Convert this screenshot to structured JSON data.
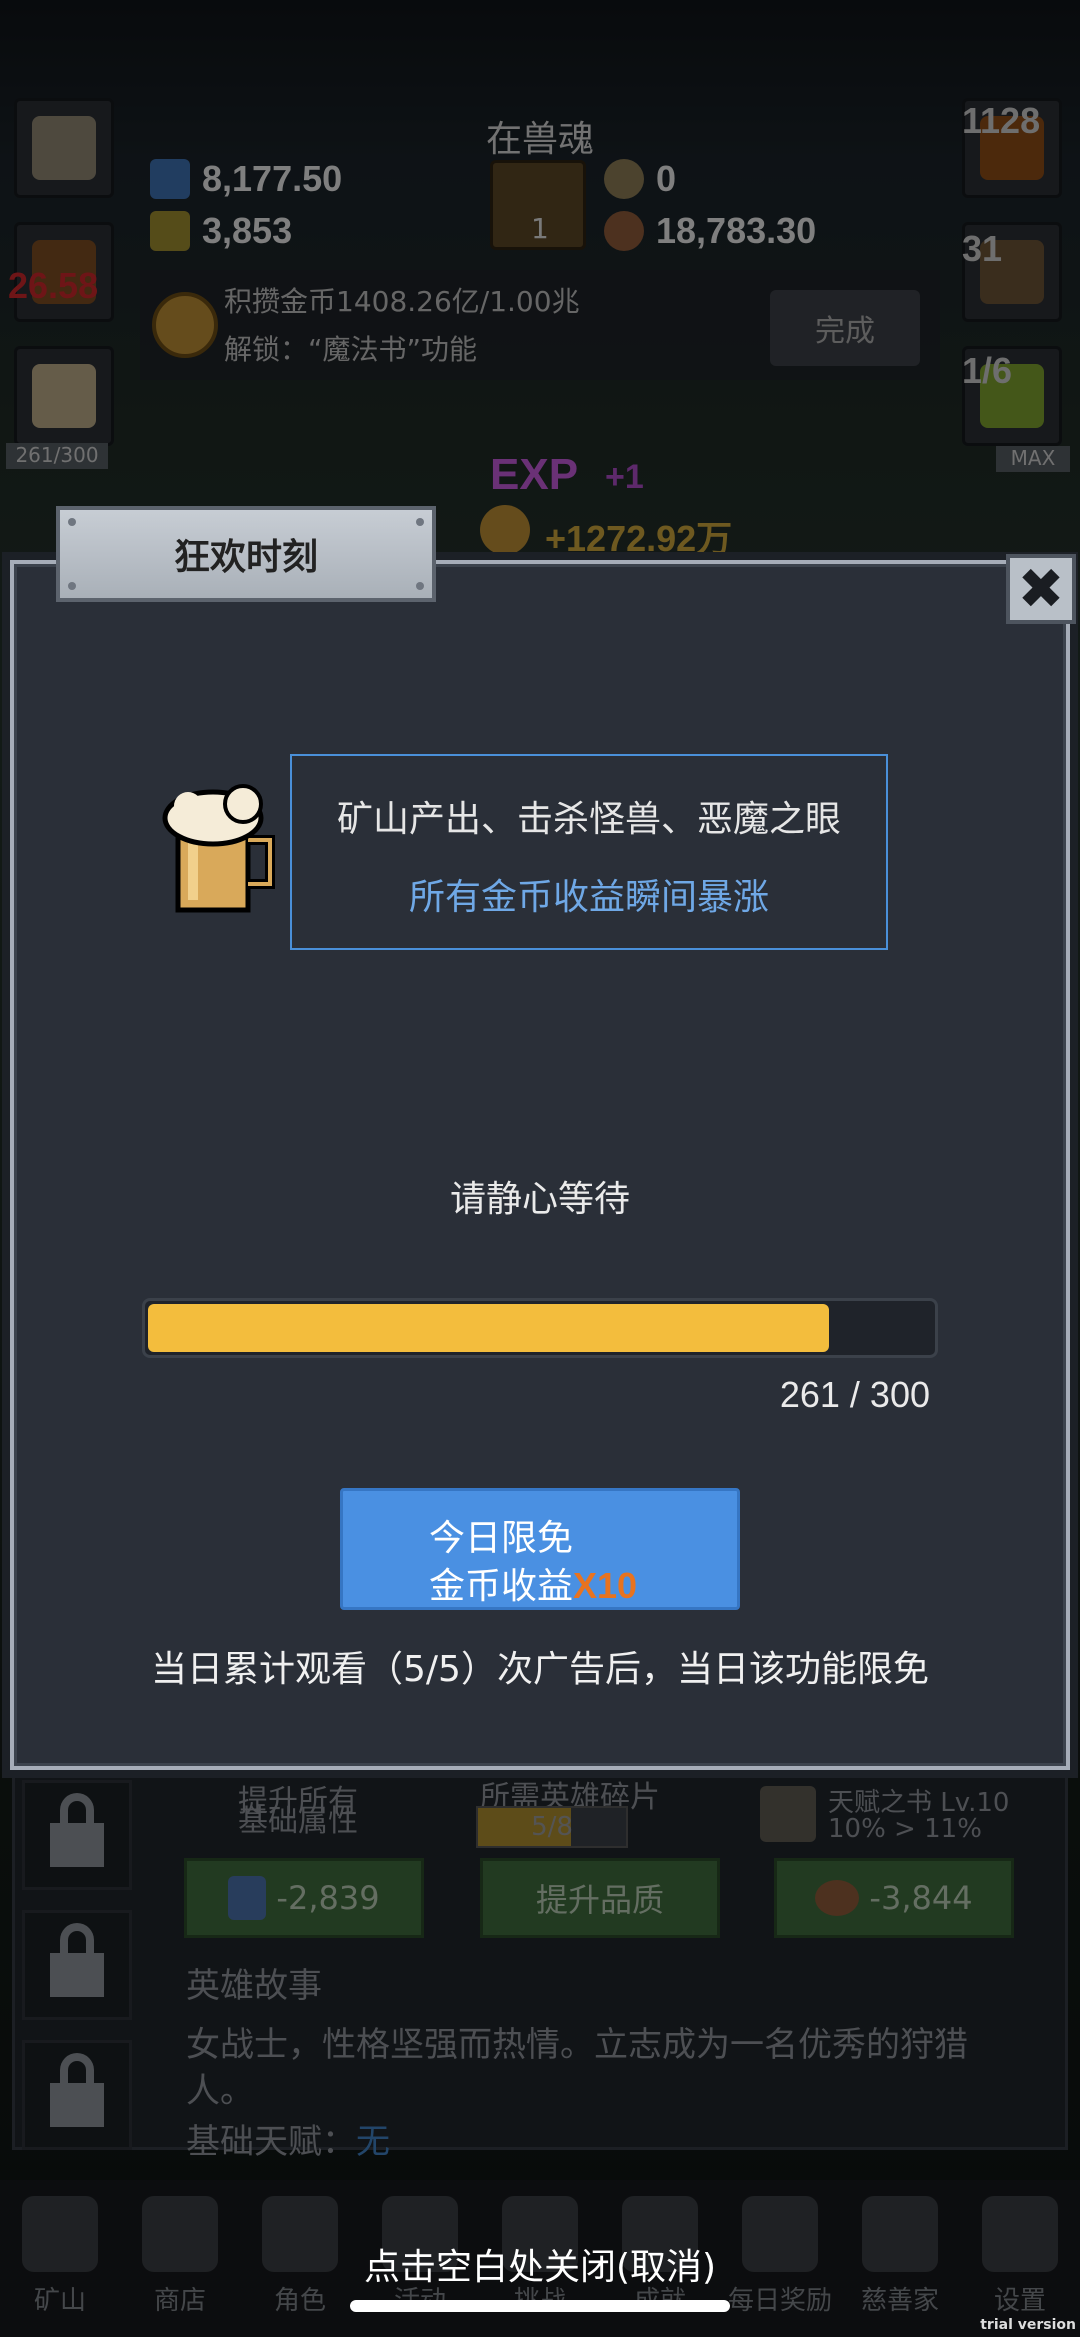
{
  "top": {
    "title": "在兽魂",
    "potion_blue": "8,177.50",
    "potion_yellow": "3,853",
    "coins": "0",
    "meat": "18,783.30",
    "book_badge": "1"
  },
  "left_side": {
    "torch_value": "26.58",
    "mug_progress": "261/300"
  },
  "right_side": {
    "potion_count": "1128",
    "chest_count": "31",
    "slime_count": "1/6",
    "slime_max": "MAX"
  },
  "quest": {
    "line1": "积攒金币1408.26亿/1.00兆",
    "line2": "解锁：“魔法书”功能",
    "done_label": "完成"
  },
  "floating": {
    "exp_label": "EXP",
    "exp_plus": "+1",
    "gold_gain": "+1272.92万"
  },
  "modal": {
    "tab_title": "狂欢时刻",
    "close_symbol": "✖",
    "info_line1": "矿山产出、击杀怪兽、恶魔之眼",
    "info_line2": "所有金币收益瞬间暴涨",
    "wait_text": "请静心等待",
    "progress": {
      "current": 261,
      "max": 300,
      "text": "261 / 300"
    },
    "ad_button": {
      "line1": "今日限免",
      "line2_prefix": "金币收益",
      "multiplier": "X10"
    },
    "ad_note": "当日累计观看（5/5）次广告后，当日该功能限免"
  },
  "background_panel": {
    "upgrade_all_1": "提升所有",
    "upgrade_all_2": "基础属性",
    "hero_req": "所需英雄碎片",
    "hero_progress": "5/8",
    "talent_book": "天赋之书 Lv.10",
    "talent_change": "10% > 11%",
    "btn_cost_1": "-2,839",
    "btn_quality": "提升品质",
    "btn_cost_3": "-3,844",
    "story_title": "英雄故事",
    "story_text": "女战士，性格坚强而热情。立志成为一名优秀的狩猎人。",
    "talent_label": "基础天赋：",
    "talent_value": "无"
  },
  "nav": {
    "items": [
      "矿山",
      "商店",
      "角色",
      "活动",
      "挑战",
      "成就",
      "每日奖励",
      "慈善家",
      "设置"
    ],
    "close_hint": "点击空白处关闭(取消)"
  },
  "watermark": "trial version",
  "colors": {
    "accent_blue": "#4a90e2",
    "progress_yellow": "#f3bd3d",
    "multiplier_orange": "#e8731f",
    "info_blue": "#6fa8e6"
  }
}
